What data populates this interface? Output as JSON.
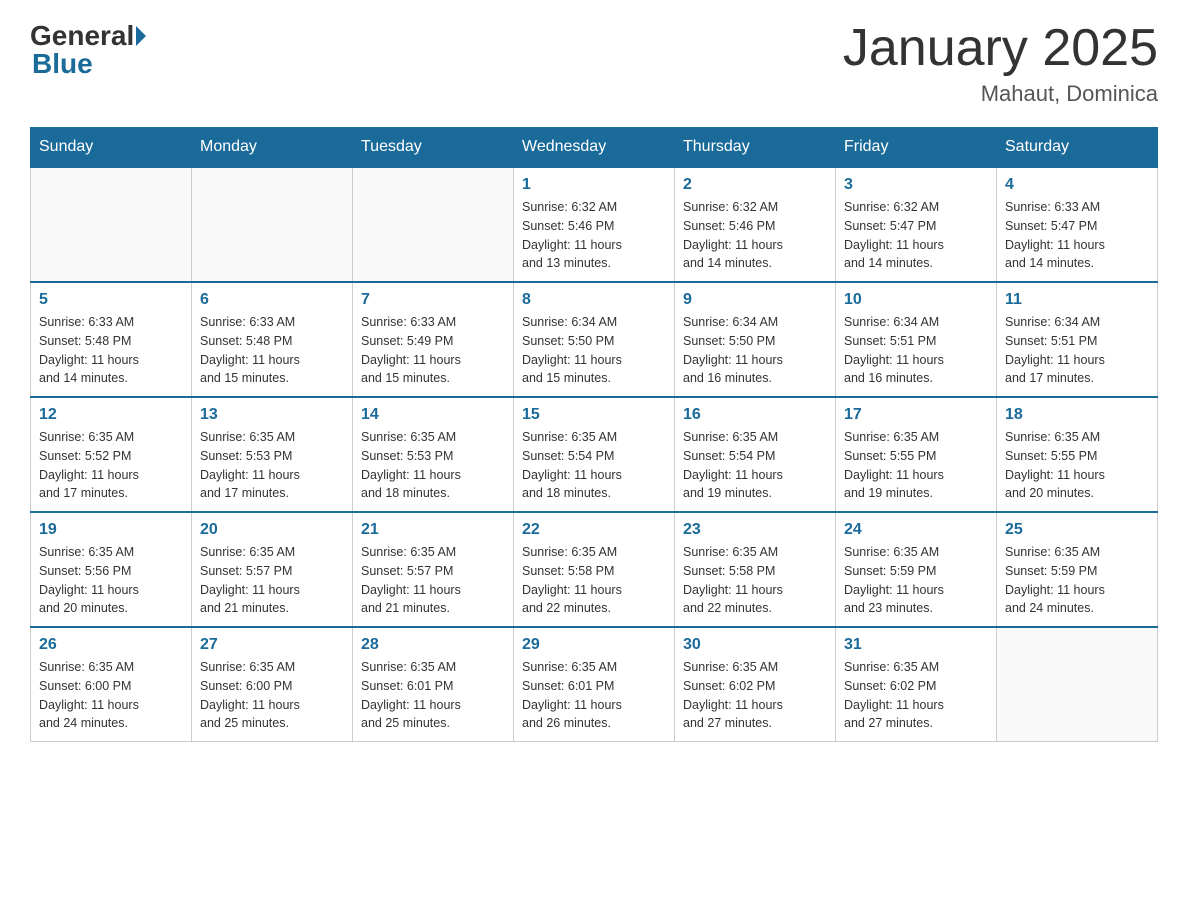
{
  "header": {
    "logo_general": "General",
    "logo_blue": "Blue",
    "month_title": "January 2025",
    "location": "Mahaut, Dominica"
  },
  "weekdays": [
    "Sunday",
    "Monday",
    "Tuesday",
    "Wednesday",
    "Thursday",
    "Friday",
    "Saturday"
  ],
  "weeks": [
    [
      {
        "day": "",
        "info": ""
      },
      {
        "day": "",
        "info": ""
      },
      {
        "day": "",
        "info": ""
      },
      {
        "day": "1",
        "info": "Sunrise: 6:32 AM\nSunset: 5:46 PM\nDaylight: 11 hours\nand 13 minutes."
      },
      {
        "day": "2",
        "info": "Sunrise: 6:32 AM\nSunset: 5:46 PM\nDaylight: 11 hours\nand 14 minutes."
      },
      {
        "day": "3",
        "info": "Sunrise: 6:32 AM\nSunset: 5:47 PM\nDaylight: 11 hours\nand 14 minutes."
      },
      {
        "day": "4",
        "info": "Sunrise: 6:33 AM\nSunset: 5:47 PM\nDaylight: 11 hours\nand 14 minutes."
      }
    ],
    [
      {
        "day": "5",
        "info": "Sunrise: 6:33 AM\nSunset: 5:48 PM\nDaylight: 11 hours\nand 14 minutes."
      },
      {
        "day": "6",
        "info": "Sunrise: 6:33 AM\nSunset: 5:48 PM\nDaylight: 11 hours\nand 15 minutes."
      },
      {
        "day": "7",
        "info": "Sunrise: 6:33 AM\nSunset: 5:49 PM\nDaylight: 11 hours\nand 15 minutes."
      },
      {
        "day": "8",
        "info": "Sunrise: 6:34 AM\nSunset: 5:50 PM\nDaylight: 11 hours\nand 15 minutes."
      },
      {
        "day": "9",
        "info": "Sunrise: 6:34 AM\nSunset: 5:50 PM\nDaylight: 11 hours\nand 16 minutes."
      },
      {
        "day": "10",
        "info": "Sunrise: 6:34 AM\nSunset: 5:51 PM\nDaylight: 11 hours\nand 16 minutes."
      },
      {
        "day": "11",
        "info": "Sunrise: 6:34 AM\nSunset: 5:51 PM\nDaylight: 11 hours\nand 17 minutes."
      }
    ],
    [
      {
        "day": "12",
        "info": "Sunrise: 6:35 AM\nSunset: 5:52 PM\nDaylight: 11 hours\nand 17 minutes."
      },
      {
        "day": "13",
        "info": "Sunrise: 6:35 AM\nSunset: 5:53 PM\nDaylight: 11 hours\nand 17 minutes."
      },
      {
        "day": "14",
        "info": "Sunrise: 6:35 AM\nSunset: 5:53 PM\nDaylight: 11 hours\nand 18 minutes."
      },
      {
        "day": "15",
        "info": "Sunrise: 6:35 AM\nSunset: 5:54 PM\nDaylight: 11 hours\nand 18 minutes."
      },
      {
        "day": "16",
        "info": "Sunrise: 6:35 AM\nSunset: 5:54 PM\nDaylight: 11 hours\nand 19 minutes."
      },
      {
        "day": "17",
        "info": "Sunrise: 6:35 AM\nSunset: 5:55 PM\nDaylight: 11 hours\nand 19 minutes."
      },
      {
        "day": "18",
        "info": "Sunrise: 6:35 AM\nSunset: 5:55 PM\nDaylight: 11 hours\nand 20 minutes."
      }
    ],
    [
      {
        "day": "19",
        "info": "Sunrise: 6:35 AM\nSunset: 5:56 PM\nDaylight: 11 hours\nand 20 minutes."
      },
      {
        "day": "20",
        "info": "Sunrise: 6:35 AM\nSunset: 5:57 PM\nDaylight: 11 hours\nand 21 minutes."
      },
      {
        "day": "21",
        "info": "Sunrise: 6:35 AM\nSunset: 5:57 PM\nDaylight: 11 hours\nand 21 minutes."
      },
      {
        "day": "22",
        "info": "Sunrise: 6:35 AM\nSunset: 5:58 PM\nDaylight: 11 hours\nand 22 minutes."
      },
      {
        "day": "23",
        "info": "Sunrise: 6:35 AM\nSunset: 5:58 PM\nDaylight: 11 hours\nand 22 minutes."
      },
      {
        "day": "24",
        "info": "Sunrise: 6:35 AM\nSunset: 5:59 PM\nDaylight: 11 hours\nand 23 minutes."
      },
      {
        "day": "25",
        "info": "Sunrise: 6:35 AM\nSunset: 5:59 PM\nDaylight: 11 hours\nand 24 minutes."
      }
    ],
    [
      {
        "day": "26",
        "info": "Sunrise: 6:35 AM\nSunset: 6:00 PM\nDaylight: 11 hours\nand 24 minutes."
      },
      {
        "day": "27",
        "info": "Sunrise: 6:35 AM\nSunset: 6:00 PM\nDaylight: 11 hours\nand 25 minutes."
      },
      {
        "day": "28",
        "info": "Sunrise: 6:35 AM\nSunset: 6:01 PM\nDaylight: 11 hours\nand 25 minutes."
      },
      {
        "day": "29",
        "info": "Sunrise: 6:35 AM\nSunset: 6:01 PM\nDaylight: 11 hours\nand 26 minutes."
      },
      {
        "day": "30",
        "info": "Sunrise: 6:35 AM\nSunset: 6:02 PM\nDaylight: 11 hours\nand 27 minutes."
      },
      {
        "day": "31",
        "info": "Sunrise: 6:35 AM\nSunset: 6:02 PM\nDaylight: 11 hours\nand 27 minutes."
      },
      {
        "day": "",
        "info": ""
      }
    ]
  ]
}
